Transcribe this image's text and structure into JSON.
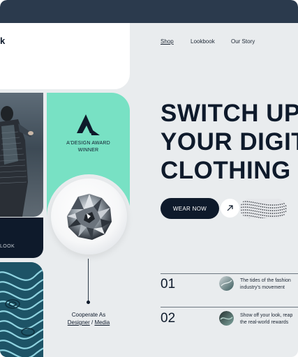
{
  "colors": {
    "dark": "#0e1a2b",
    "mint": "#78e1c4",
    "background": "#e9ecee",
    "topbar": "#2b3a4d"
  },
  "brand": {
    "logo_fragment": "k"
  },
  "nav": {
    "items": [
      "Shop",
      "Lookbook",
      "Our Story"
    ]
  },
  "side": {
    "cta_fragment": "LOOK"
  },
  "award": {
    "icon": "adesign-a-logo-icon",
    "line1": "A'DESIGN AWARD",
    "line2": "WINNER"
  },
  "cooperate": {
    "text": "Cooperate As",
    "designer": "Designer",
    "separator": " / ",
    "media": "Media"
  },
  "hero": {
    "line1": "SWITCH UP",
    "line2": "YOUR DIGIT",
    "line3": "CLOTHING"
  },
  "cta": {
    "button_label": "WEAR NOW",
    "arrow_icon": "arrow-up-right-icon"
  },
  "list": [
    {
      "number": "01",
      "line1": "The tides of the fashion",
      "line2": "industry's movement"
    },
    {
      "number": "02",
      "line1": "Show off your look, reap",
      "line2": "the real-world rewards"
    }
  ]
}
